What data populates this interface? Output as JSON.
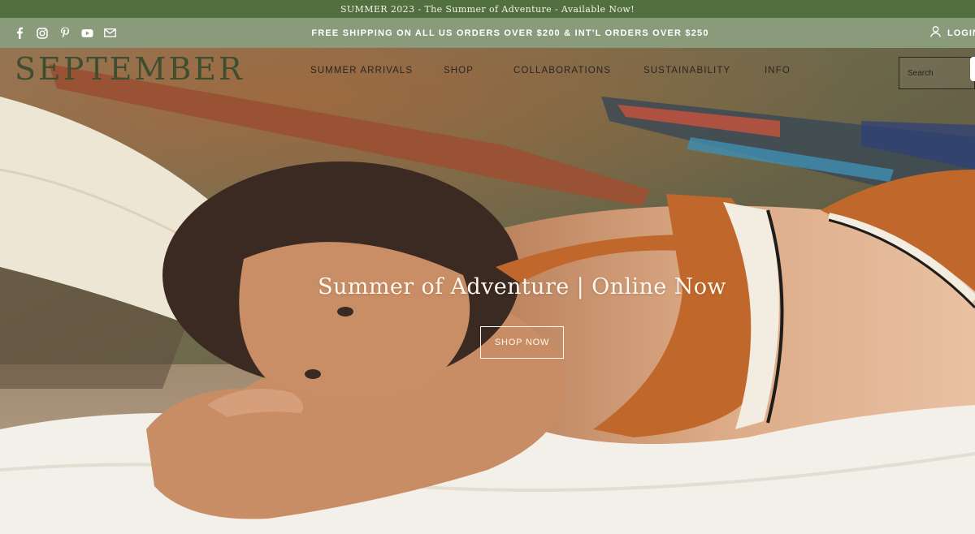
{
  "promo": {
    "text": "SUMMER 2023 - The Summer of Adventure - Available Now!"
  },
  "utility": {
    "shipping": "FREE SHIPPING ON ALL US ORDERS OVER $200 & INT'L ORDERS OVER $250",
    "login": "LOGIN",
    "social_icons": [
      "facebook-icon",
      "instagram-icon",
      "pinterest-icon",
      "youtube-icon",
      "mail-icon"
    ]
  },
  "header": {
    "logo": "SEPTEMBER",
    "nav": [
      "SUMMER ARRIVALS",
      "SHOP",
      "COLLABORATIONS",
      "SUSTAINABILITY",
      "INFO"
    ],
    "search_placeholder": "Search"
  },
  "hero": {
    "headline": "Summer of Adventure | Online Now",
    "cta": "SHOP NOW"
  },
  "colors": {
    "promo_bg": "#526f3f",
    "utility_bg": "#8a9b7c",
    "logo": "#3e4f2f",
    "swimsuit": "#c0682c"
  }
}
